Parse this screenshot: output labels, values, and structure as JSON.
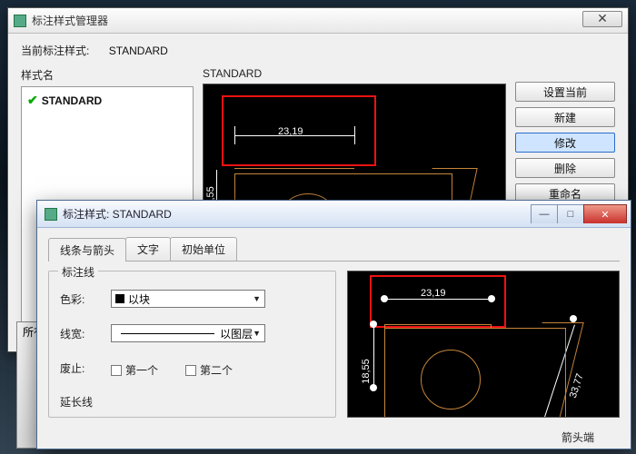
{
  "dlg1": {
    "title": "标注样式管理器",
    "current_label": "当前标注样式:",
    "current_value": "STANDARD",
    "list_label": "样式名",
    "styles": [
      {
        "name": "STANDARD",
        "checked": true
      }
    ],
    "preview_label": "STANDARD",
    "buttons": {
      "set_current": "设置当前",
      "new": "新建",
      "modify": "修改",
      "delete": "删除",
      "rename": "重命名"
    },
    "all_styles_btn": "所有"
  },
  "dlg2": {
    "title": "标注样式: STANDARD",
    "tabs": {
      "lines_arrows": "线条与箭头",
      "text": "文字",
      "units": "初始单位"
    },
    "group_label": "标注线",
    "color_label": "色彩:",
    "color_value": "以块",
    "lineweight_label": "线宽:",
    "lineweight_value": "以图层",
    "suppress_label": "废止:",
    "suppress_1": "第一个",
    "suppress_2": "第二个",
    "ext_label": "延长线",
    "arrowhead_label": "箭头端"
  },
  "preview": {
    "dim_h": "23,19",
    "dim_v": "18,55",
    "dim_diag": "33,77"
  },
  "window": {
    "min": "—",
    "max": "□",
    "close": "✕"
  }
}
